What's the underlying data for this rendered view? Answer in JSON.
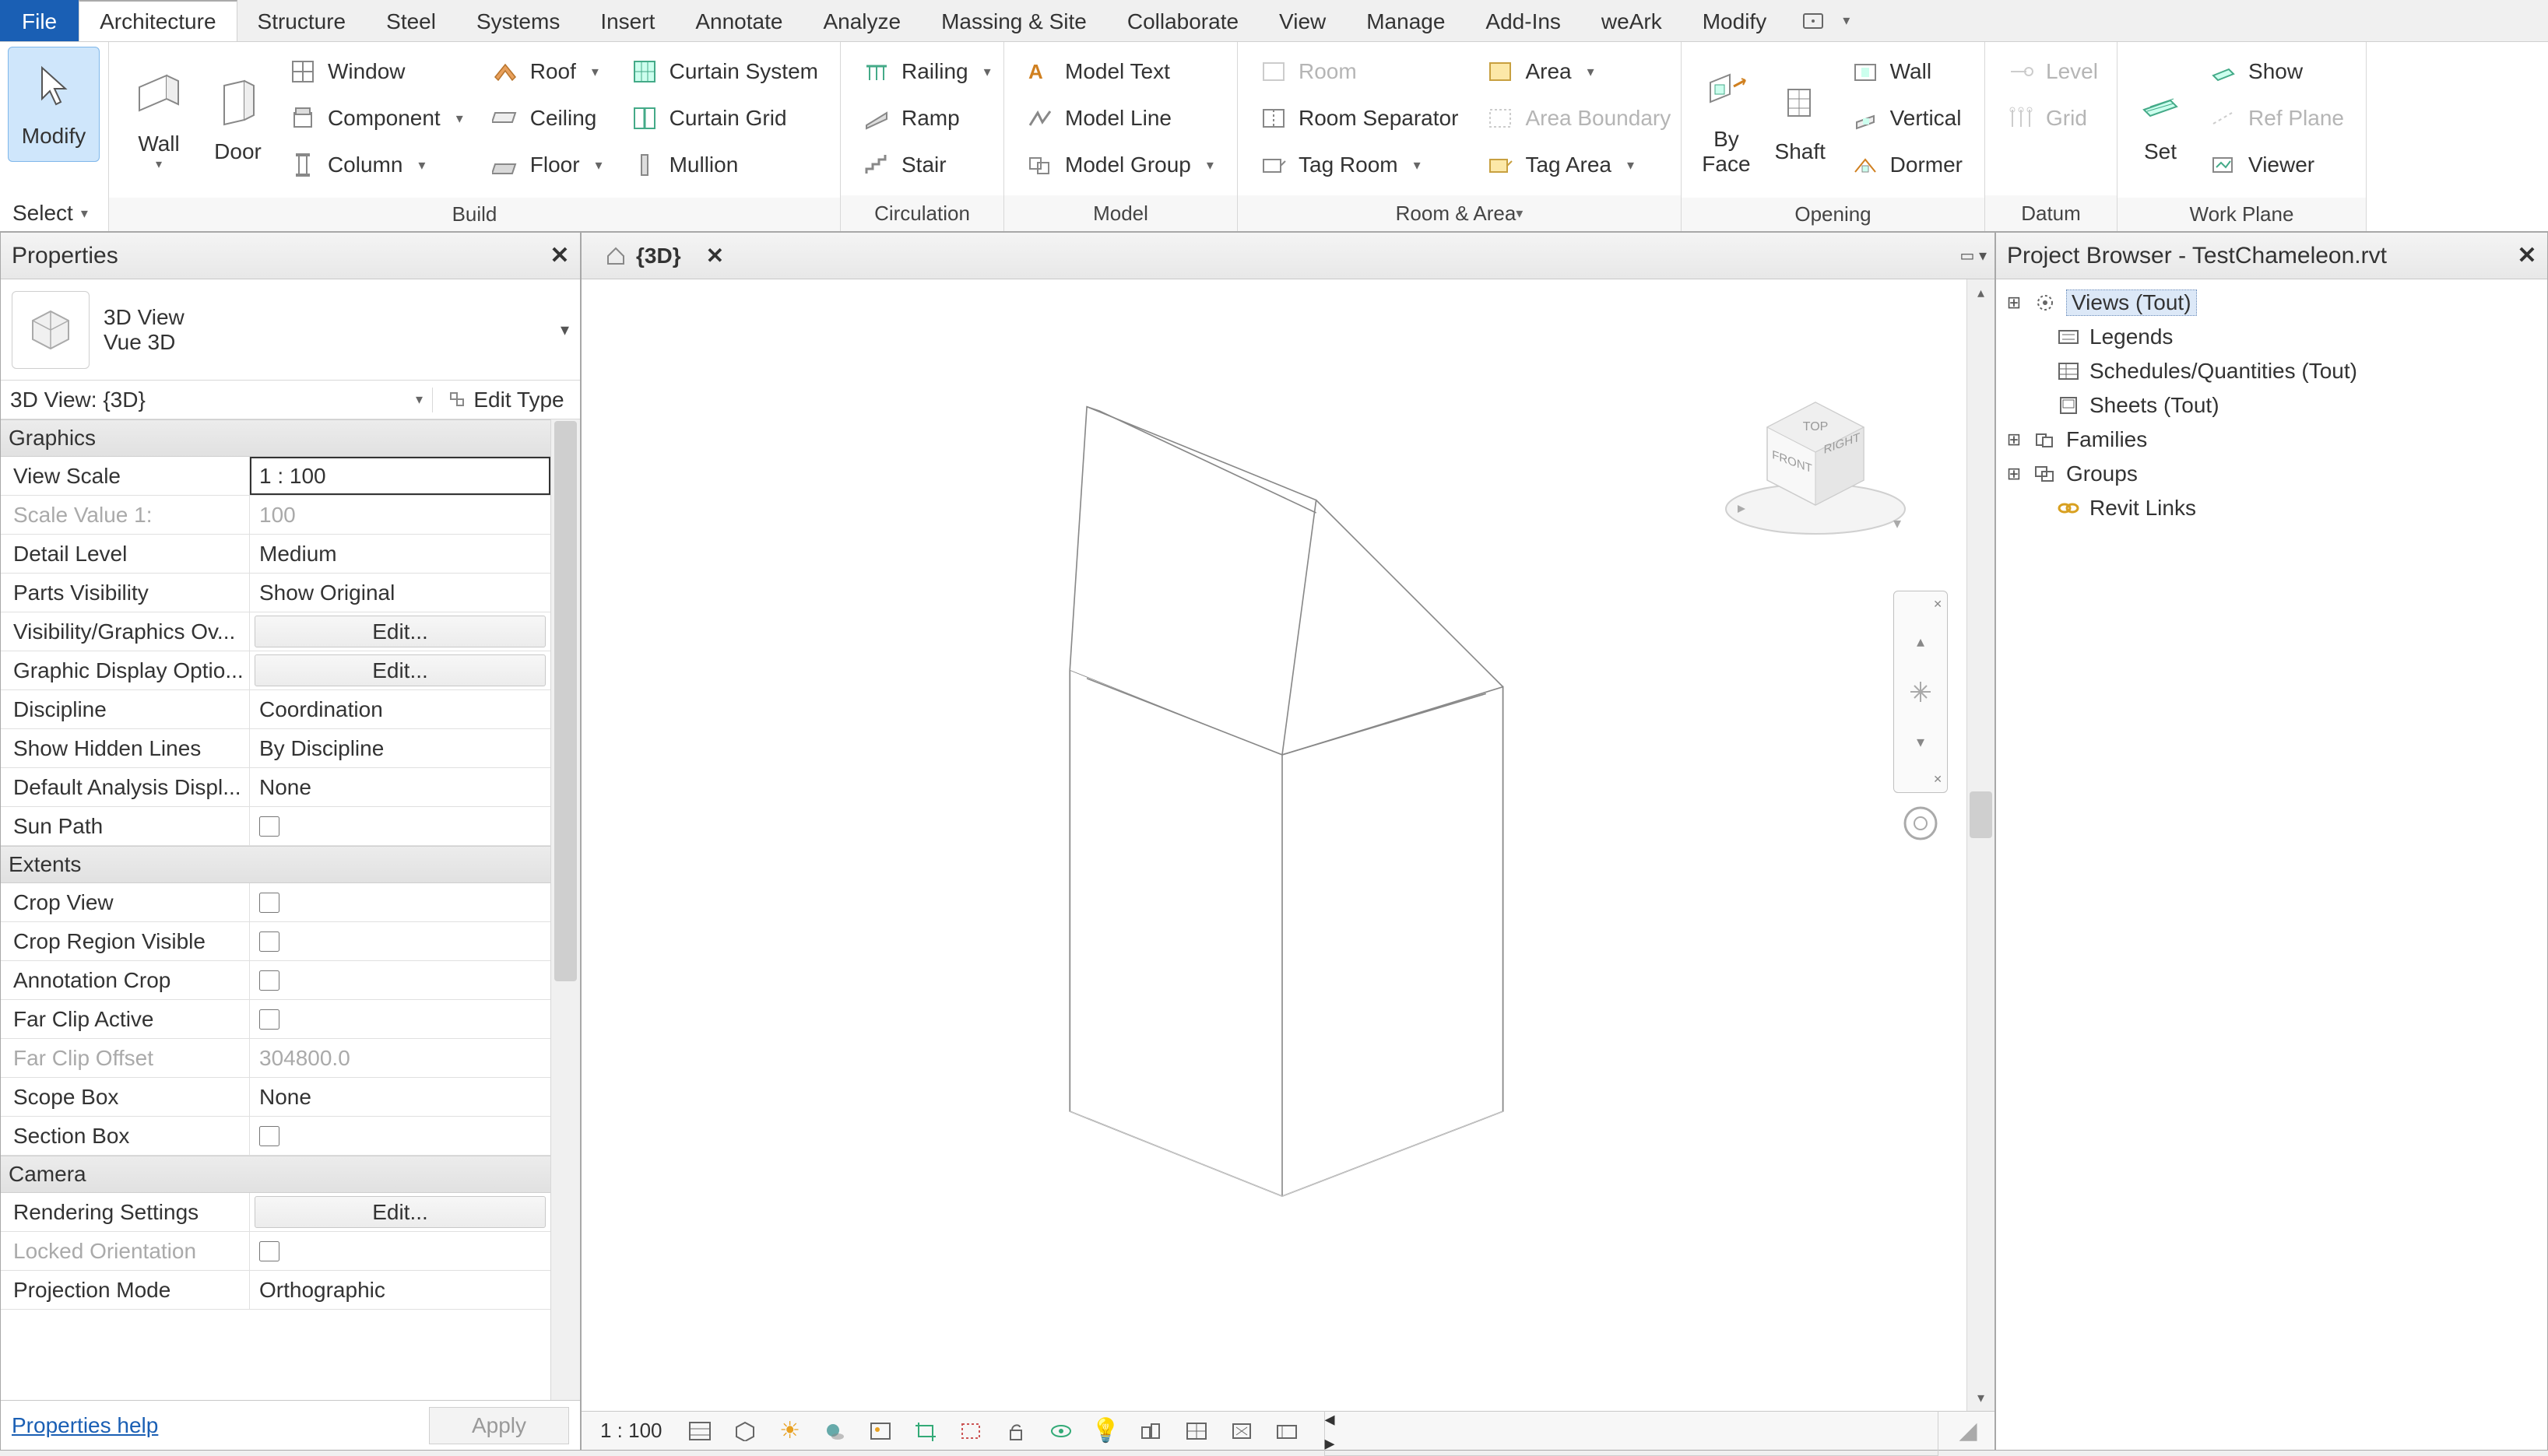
{
  "menubar": {
    "file": "File",
    "tabs": [
      "Architecture",
      "Structure",
      "Steel",
      "Systems",
      "Insert",
      "Annotate",
      "Analyze",
      "Massing & Site",
      "Collaborate",
      "View",
      "Manage",
      "Add-Ins",
      "weArk",
      "Modify"
    ],
    "active": "Architecture"
  },
  "ribbon": {
    "select": {
      "modify": "Modify",
      "label": "Select"
    },
    "build": {
      "label": "Build",
      "wall": "Wall",
      "door": "Door",
      "window": "Window",
      "component": "Component",
      "column": "Column",
      "roof": "Roof",
      "ceiling": "Ceiling",
      "floor": "Floor",
      "curtain_system": "Curtain  System",
      "curtain_grid": "Curtain  Grid",
      "mullion": "Mullion"
    },
    "circulation": {
      "label": "Circulation",
      "railing": "Railing",
      "ramp": "Ramp",
      "stair": "Stair"
    },
    "model": {
      "label": "Model",
      "text": "Model  Text",
      "line": "Model  Line",
      "group": "Model  Group"
    },
    "room_area": {
      "label": "Room & Area",
      "room": "Room",
      "room_sep": "Room  Separator",
      "tag_room": "Tag  Room",
      "area": "Area",
      "area_boundary": "Area  Boundary",
      "tag_area": "Tag  Area"
    },
    "opening": {
      "label": "Opening",
      "by_face": "By\nFace",
      "shaft": "Shaft",
      "wall": "Wall",
      "vertical": "Vertical",
      "dormer": "Dormer"
    },
    "datum": {
      "label": "Datum",
      "level": "Level",
      "grid": "Grid"
    },
    "work_plane": {
      "label": "Work Plane",
      "set": "Set",
      "show": "Show",
      "ref_plane": "Ref  Plane",
      "viewer": "Viewer"
    }
  },
  "properties": {
    "title": "Properties",
    "type_family": "3D View",
    "type_name": "Vue 3D",
    "instance": "3D View: {3D}",
    "edit_type": "Edit Type",
    "groups": [
      {
        "name": "Graphics",
        "rows": [
          {
            "k": "View Scale",
            "v": "1 : 100",
            "active": true
          },
          {
            "k": "Scale Value    1:",
            "v": "100",
            "dim": true
          },
          {
            "k": "Detail Level",
            "v": "Medium"
          },
          {
            "k": "Parts Visibility",
            "v": "Show Original"
          },
          {
            "k": "Visibility/Graphics Ov...",
            "v": "Edit...",
            "btn": true
          },
          {
            "k": "Graphic Display Optio...",
            "v": "Edit...",
            "btn": true
          },
          {
            "k": "Discipline",
            "v": "Coordination"
          },
          {
            "k": "Show Hidden Lines",
            "v": "By Discipline"
          },
          {
            "k": "Default Analysis Displ...",
            "v": "None"
          },
          {
            "k": "Sun Path",
            "cb": true,
            "checked": false
          }
        ]
      },
      {
        "name": "Extents",
        "rows": [
          {
            "k": "Crop View",
            "cb": true,
            "checked": false
          },
          {
            "k": "Crop Region Visible",
            "cb": true,
            "checked": false
          },
          {
            "k": "Annotation Crop",
            "cb": true,
            "checked": false
          },
          {
            "k": "Far Clip Active",
            "cb": true,
            "checked": false
          },
          {
            "k": "Far Clip Offset",
            "v": "304800.0",
            "dim": true
          },
          {
            "k": "Scope Box",
            "v": "None"
          },
          {
            "k": "Section Box",
            "cb": true,
            "checked": false
          }
        ]
      },
      {
        "name": "Camera",
        "rows": [
          {
            "k": "Rendering Settings",
            "v": "Edit...",
            "btn": true
          },
          {
            "k": "Locked Orientation",
            "cb": true,
            "checked": false,
            "dim": true
          },
          {
            "k": "Projection Mode",
            "v": "Orthographic"
          }
        ]
      }
    ],
    "help": "Properties help",
    "apply": "Apply"
  },
  "view": {
    "tab_name": "{3D}"
  },
  "view_control": {
    "scale": "1 : 100"
  },
  "viewcube": {
    "top": "TOP",
    "front": "FRONT",
    "right": "RIGHT"
  },
  "browser": {
    "title": "Project Browser - TestChameleon.rvt",
    "items": [
      {
        "tw": "+",
        "icon": "views",
        "label": "Views (Tout)",
        "sel": true,
        "indent": 0
      },
      {
        "tw": "",
        "icon": "legend",
        "label": "Legends",
        "indent": 1
      },
      {
        "tw": "",
        "icon": "schedule",
        "label": "Schedules/Quantities (Tout)",
        "indent": 1
      },
      {
        "tw": "",
        "icon": "sheet",
        "label": "Sheets (Tout)",
        "indent": 1
      },
      {
        "tw": "+",
        "icon": "family",
        "label": "Families",
        "indent": 0
      },
      {
        "tw": "+",
        "icon": "group",
        "label": "Groups",
        "indent": 0
      },
      {
        "tw": "",
        "icon": "link",
        "label": "Revit Links",
        "indent": 1
      }
    ]
  }
}
